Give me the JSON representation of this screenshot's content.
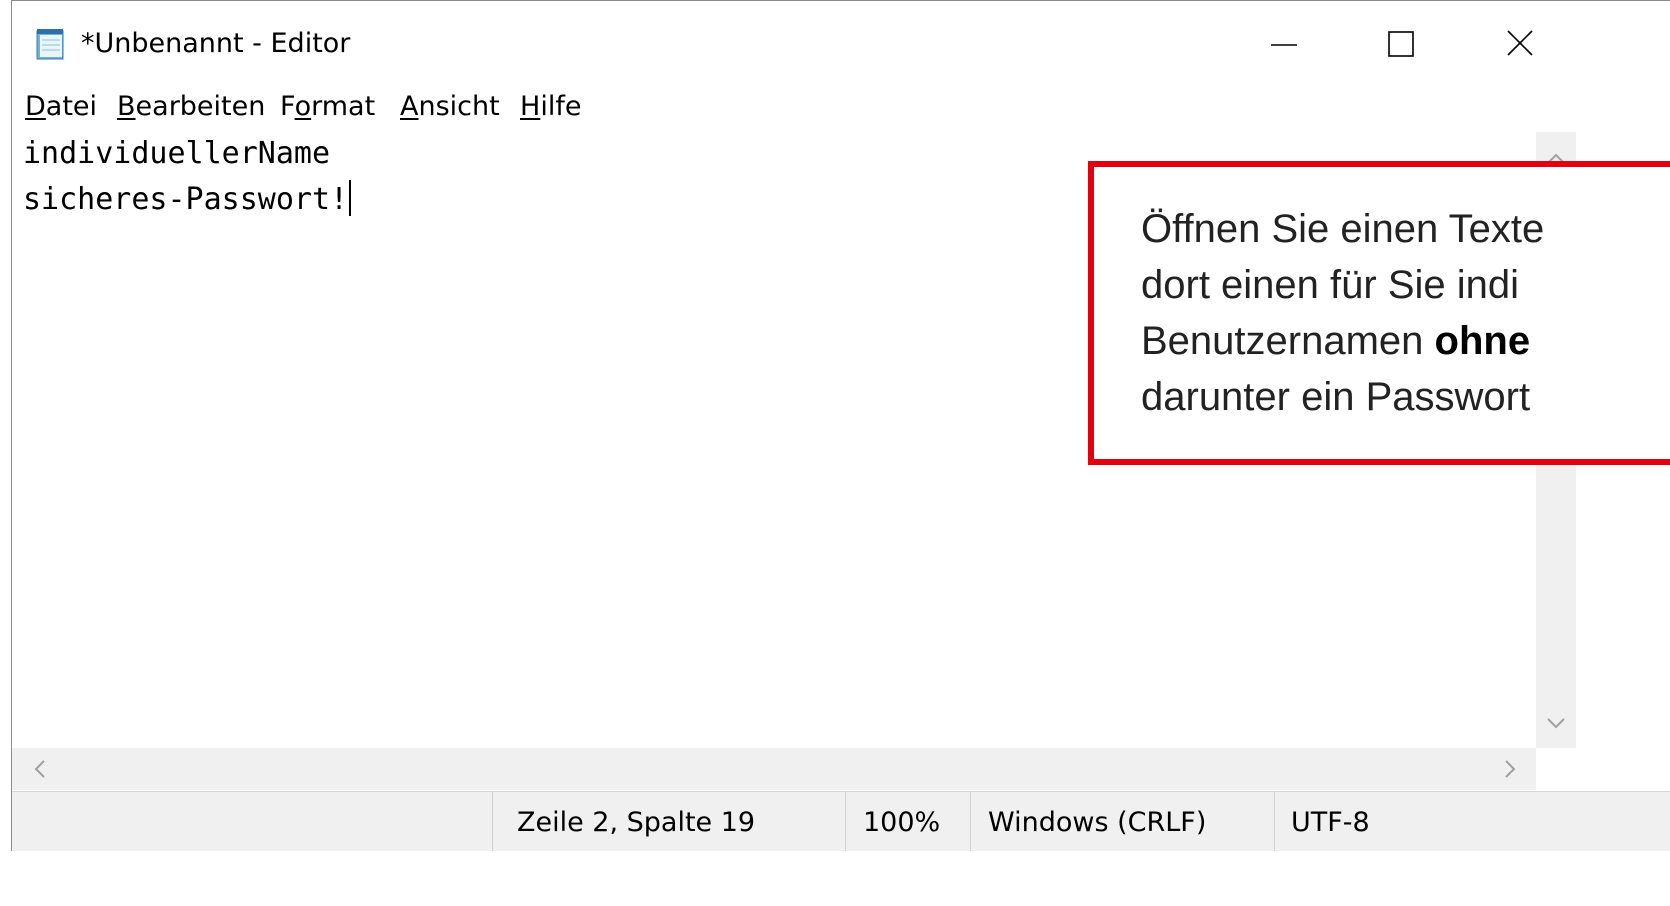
{
  "window": {
    "title": "*Unbenannt - Editor",
    "app_icon": "notepad-icon",
    "controls": [
      "minimize-icon",
      "maximize-icon",
      "close-icon"
    ]
  },
  "menu": {
    "items": [
      {
        "label": "Datei",
        "accel": "D",
        "rest": "atei"
      },
      {
        "label": "Bearbeiten",
        "accel": "B",
        "rest": "earbeiten"
      },
      {
        "label": "Format",
        "pre": "F",
        "accel": "o",
        "rest": "rmat"
      },
      {
        "label": "Ansicht",
        "accel": "A",
        "rest": "nsicht"
      },
      {
        "label": "Hilfe",
        "accel": "H",
        "rest": "ilfe"
      }
    ]
  },
  "editor": {
    "lines": [
      "individuellerName",
      "sicheres-Passwort!"
    ]
  },
  "callout": {
    "line1": "Öffnen Sie einen Texte",
    "line2": "dort einen für Sie indi",
    "line3_pre": "Benutzernamen ",
    "line3_bold": "ohne",
    "line4": "darunter ein Passwort",
    "border_color": "#e3000f"
  },
  "status": {
    "position": "Zeile 2, Spalte 19",
    "zoom": "100%",
    "line_ending": "Windows (CRLF)",
    "encoding": "UTF-8"
  }
}
